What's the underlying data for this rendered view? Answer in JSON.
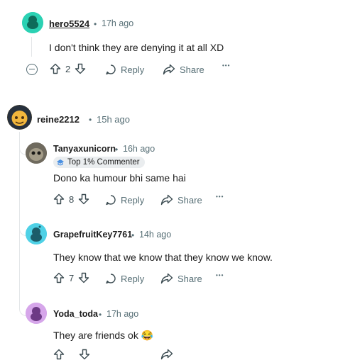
{
  "comments": [
    {
      "username": "hero5524",
      "time": "17h ago",
      "text": "I don't think they are denying it at all XD",
      "votes": "2",
      "reply_label": "Reply",
      "share_label": "Share",
      "avatar_color": "#2bd1b3"
    },
    {
      "username": "reine2212",
      "time": "15h ago",
      "avatar_color": "#f2b63c"
    },
    {
      "username": "Tanyaxunicorn",
      "time": "16h ago",
      "badge": "Top 1% Commenter",
      "text": "Dono ka humour bhi same hai",
      "votes": "8",
      "reply_label": "Reply",
      "share_label": "Share",
      "avatar_color": "#7a7466"
    },
    {
      "username": "GrapefruitKey7761",
      "time": "14h ago",
      "text": "They know that we know that they know we know.",
      "votes": "7",
      "reply_label": "Reply",
      "share_label": "Share",
      "avatar_color": "#4fd1e6"
    },
    {
      "username": "Yoda_toda",
      "time": "17h ago",
      "text": "They are friends ok 😂",
      "avatar_color": "#d6a6ea"
    }
  ],
  "separator": "•",
  "more_label": "•••",
  "icons": {
    "upvote": "upvote-icon",
    "downvote": "downvote-icon",
    "reply": "reply-icon",
    "share": "share-icon",
    "collapse": "collapse-icon",
    "badge": "top-commenter-badge-icon"
  }
}
